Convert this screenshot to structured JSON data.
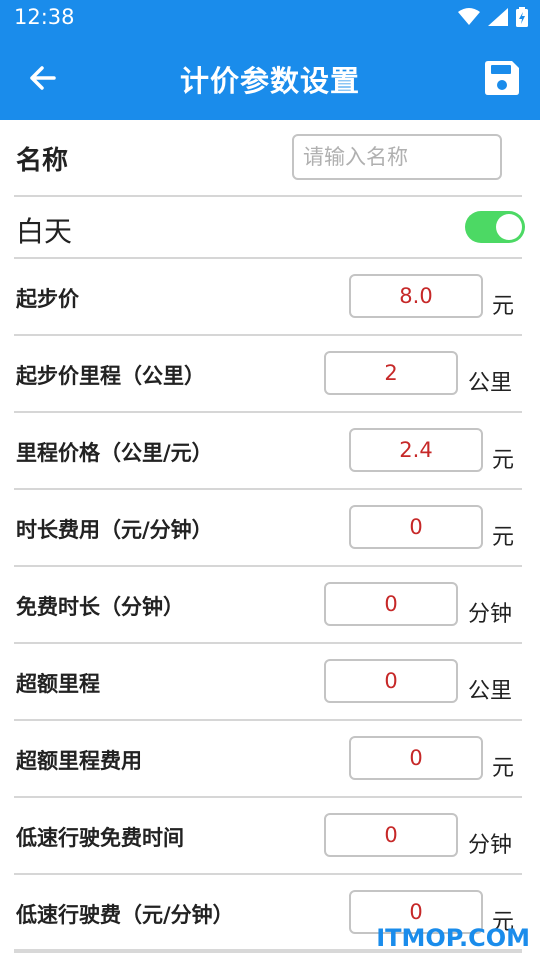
{
  "status_bar": {
    "time": "12:38",
    "icons": [
      "wifi-icon",
      "signal-icon",
      "battery-charging-icon"
    ]
  },
  "app_bar": {
    "title": "计价参数设置",
    "back_icon": "arrow-left-icon",
    "save_icon": "floppy-disk-icon"
  },
  "name_row": {
    "label": "名称",
    "placeholder": "请输入名称"
  },
  "day_row": {
    "label": "白天",
    "toggle_on": true
  },
  "fields": [
    {
      "label": "起步价",
      "value": "8.0",
      "unit": "元"
    },
    {
      "label": "起步价里程（公里）",
      "value": "2",
      "unit": "公里"
    },
    {
      "label": "里程价格（公里/元）",
      "value": "2.4",
      "unit": "元"
    },
    {
      "label": "时长费用（元/分钟）",
      "value": "0",
      "unit": "元"
    },
    {
      "label": "免费时长（分钟）",
      "value": "0",
      "unit": "分钟"
    },
    {
      "label": "超额里程",
      "value": "0",
      "unit": "公里"
    },
    {
      "label": "超额里程费用",
      "value": "0",
      "unit": "元"
    },
    {
      "label": "低速行驶免费时间",
      "value": "0",
      "unit": "分钟"
    },
    {
      "label": "低速行驶费（元/分钟）",
      "value": "0",
      "unit": "元"
    }
  ],
  "watermark": "ITMOP.COM",
  "colors": {
    "primary": "#1a8ceb",
    "value_text": "#c62828",
    "toggle_on": "#4cd964"
  }
}
